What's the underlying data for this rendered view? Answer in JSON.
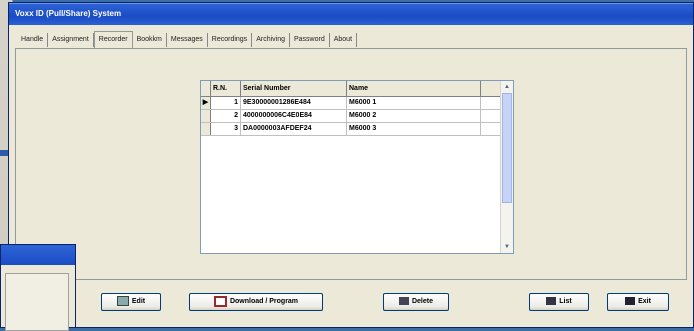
{
  "window": {
    "title": "Voxx ID (Pull/Share) System"
  },
  "tabs": [
    "Handle",
    "Assignment",
    "Recorder",
    "Bookkm",
    "Messages",
    "Recordings",
    "Archiving",
    "Password",
    "About"
  ],
  "active_tab": "Recorder",
  "grid": {
    "columns": [
      "R.N.",
      "Serial Number",
      "Name"
    ],
    "rows": [
      {
        "sn": "1",
        "serial": "9E30000001286E484",
        "name": "M6000 1"
      },
      {
        "sn": "2",
        "serial": "4000000006C4E0E84",
        "name": "M6000 2"
      },
      {
        "sn": "3",
        "serial": "DA0000003AFDEF24",
        "name": "M6000 3"
      }
    ],
    "current_row_marker": "▶"
  },
  "buttons": {
    "edit": "Edit",
    "download": "Download / Program",
    "delete": "Delete",
    "list": "List",
    "exit": "Exit"
  },
  "icons": {
    "edit": "edit-icon",
    "download": "download-icon",
    "delete": "delete-icon",
    "list": "list-icon",
    "exit": "exit-icon",
    "scroll_up": "scroll-up-icon",
    "scroll_down": "scroll-down-icon"
  },
  "colors": {
    "titlebar": "#1a4cc4",
    "desktop": "#3a6ea5",
    "panel": "#ece9d8"
  }
}
